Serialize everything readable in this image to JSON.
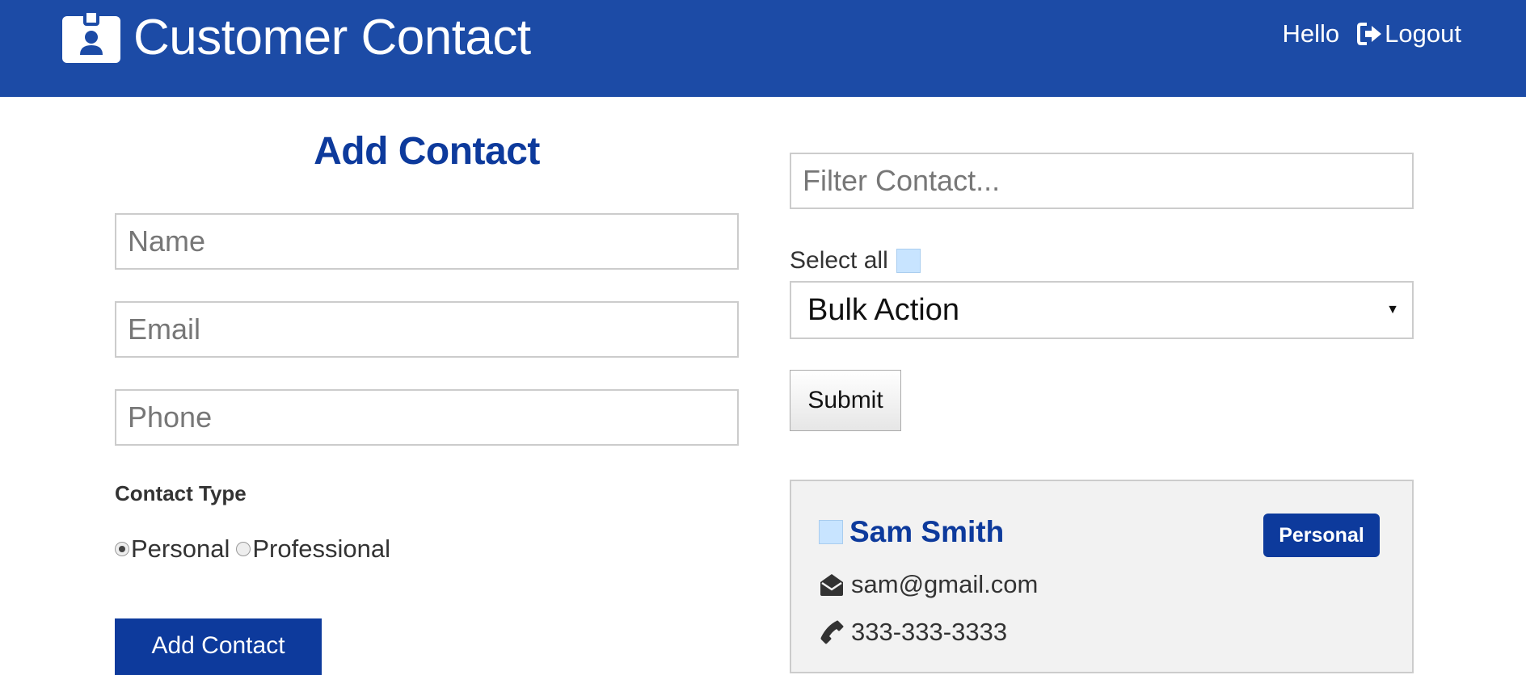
{
  "header": {
    "title": "Customer Contact",
    "hello": "Hello",
    "logout": "Logout",
    "brand_icon": "id-badge-icon",
    "logout_icon": "sign-out-icon",
    "bg_color": "#1c4ba6"
  },
  "add_form": {
    "heading": "Add Contact",
    "name_placeholder": "Name",
    "email_placeholder": "Email",
    "phone_placeholder": "Phone",
    "contact_type_label": "Contact Type",
    "options": [
      {
        "label": "Personal",
        "checked": true
      },
      {
        "label": "Professional",
        "checked": false
      }
    ],
    "submit_label": "Add Contact",
    "accent_color": "#0d3a9c"
  },
  "list": {
    "filter_placeholder": "Filter Contact...",
    "select_all_label": "Select all",
    "bulk_action_selected": "Bulk Action",
    "submit_label": "Submit",
    "contacts": [
      {
        "name": "Sam Smith",
        "type": "Personal",
        "email": "sam@gmail.com",
        "phone": "333-333-3333",
        "email_icon": "envelope-open-icon",
        "phone_icon": "phone-icon"
      }
    ]
  }
}
